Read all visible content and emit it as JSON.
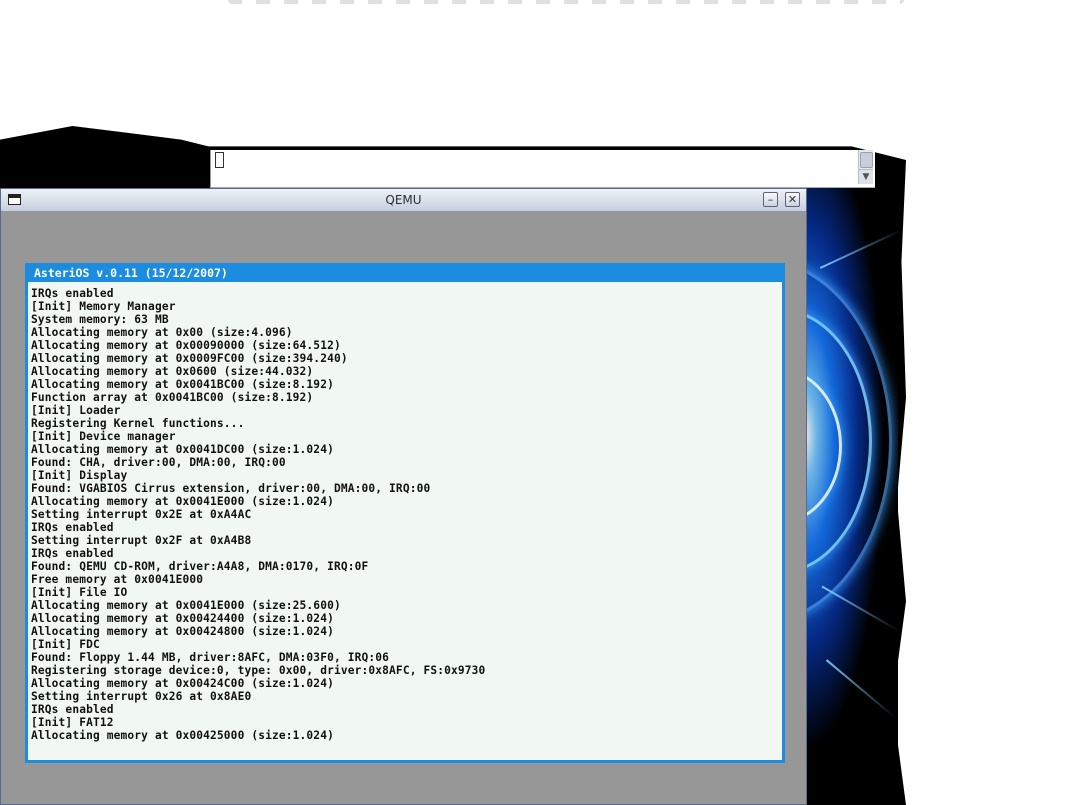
{
  "window": {
    "title": "QEMU"
  },
  "guest": {
    "header": "AsteriOS v.0.11 (15/12/2007)",
    "lines": [
      "IRQs enabled",
      "[Init] Memory Manager",
      "System memory: 63 MB",
      "Allocating memory at 0x00 (size:4.096)",
      "Allocating memory at 0x00090000 (size:64.512)",
      "Allocating memory at 0x0009FC00 (size:394.240)",
      "Allocating memory at 0x0600 (size:44.032)",
      "Allocating memory at 0x0041BC00 (size:8.192)",
      "Function array at 0x0041BC00 (size:8.192)",
      "[Init] Loader",
      "Registering Kernel functions...",
      "[Init] Device manager",
      "Allocating memory at 0x0041DC00 (size:1.024)",
      "Found: CHA, driver:00, DMA:00, IRQ:00",
      "[Init] Display",
      "Found: VGABIOS Cirrus extension, driver:00, DMA:00, IRQ:00",
      "Allocating memory at 0x0041E000 (size:1.024)",
      "Setting interrupt 0x2E at 0xA4AC",
      "IRQs enabled",
      "Setting interrupt 0x2F at 0xA4B8",
      "IRQs enabled",
      "Found: QEMU CD-ROM, driver:A4A8, DMA:0170, IRQ:0F",
      "Free memory at 0x0041E000",
      "[Init] File IO",
      "Allocating memory at 0x0041E000 (size:25.600)",
      "Allocating memory at 0x00424400 (size:1.024)",
      "Allocating memory at 0x00424800 (size:1.024)",
      "[Init] FDC",
      "Found: Floppy 1.44 MB, driver:8AFC, DMA:03F0, IRQ:06",
      "Registering storage device:0, type: 0x00, driver:0x8AFC, FS:0x9730",
      "Allocating memory at 0x00424C00 (size:1.024)",
      "Setting interrupt 0x26 at 0x8AE0",
      "IRQs enabled",
      "[Init] FAT12",
      "Allocating memory at 0x00425000 (size:1.024)"
    ]
  },
  "icons": {
    "menu": "window-menu-icon",
    "minimize": "minimize-icon",
    "close": "close-icon",
    "scroll_down": "chevron-down-icon"
  },
  "colors": {
    "guest_accent": "#1b8ce0",
    "guest_background": "#f1f8f3",
    "qemu_background": "#979797"
  }
}
